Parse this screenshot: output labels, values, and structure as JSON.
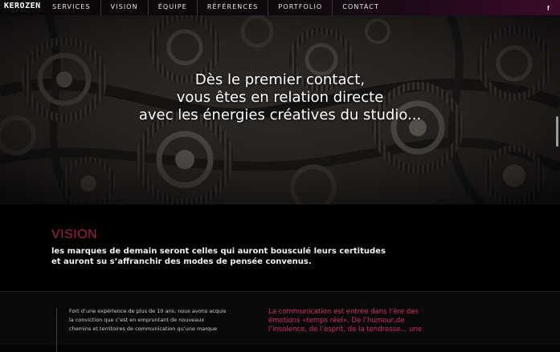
{
  "brand": {
    "logo": "KEROZEN"
  },
  "nav": {
    "items": [
      "SERVICES",
      "VISION",
      "ÉQUIPE",
      "RÉFÉRENCES",
      "PORTFOLIO",
      "CONTACT"
    ],
    "social": "f"
  },
  "hero": {
    "lines": [
      "Dès le premier contact,",
      "vous êtes en relation directe",
      "avec les énergies créatives du studio..."
    ]
  },
  "vision": {
    "title": "VISION",
    "lead_line1": "les marques de demain seront celles qui auront bousculé leurs certitudes",
    "lead_line2": "et auront su s’affranchir des modes de pensée convenus."
  },
  "bottom": {
    "left_lines": [
      "Fort d’une expérience de plus de 10 ans, nous avons acquis",
      "la conviction que c’est en empruntant de nouveaux",
      "chemins et territoires de communication qu’une marque"
    ],
    "right_lines": [
      "La communication est entrée dans l’ère des",
      "émotions «temps réel». De l’humour,de",
      "l’insolence, de l’esprit, de la tendresse... une"
    ]
  },
  "colors": {
    "accent": "#a81e4a",
    "accent_text": "#d12d63",
    "nav_gradient_end": "#3a0c28"
  }
}
